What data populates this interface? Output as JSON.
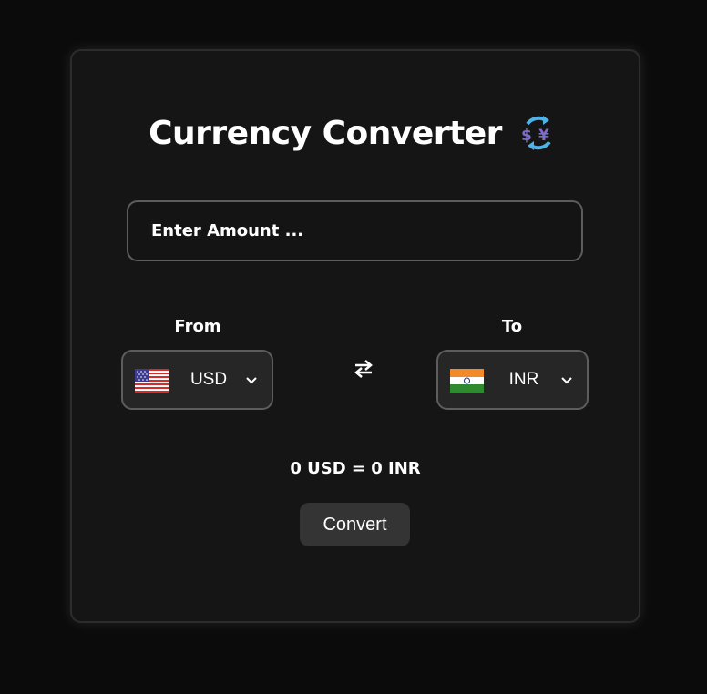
{
  "header": {
    "title": "Currency Converter",
    "icon": "currency-exchange-icon"
  },
  "amount": {
    "placeholder": "Enter Amount ...",
    "value": ""
  },
  "from": {
    "label": "From",
    "currency": "USD",
    "flag": "us-flag-icon"
  },
  "to": {
    "label": "To",
    "currency": "INR",
    "flag": "india-flag-icon"
  },
  "swap": {
    "icon": "swap-arrows-icon"
  },
  "result": {
    "text": "0 USD = 0 INR"
  },
  "convert_label": "Convert",
  "colors": {
    "background": "#0b0b0b",
    "card": "#151515",
    "select_bg": "#262626",
    "button_bg": "#343434",
    "border": "#5c5c5c"
  }
}
